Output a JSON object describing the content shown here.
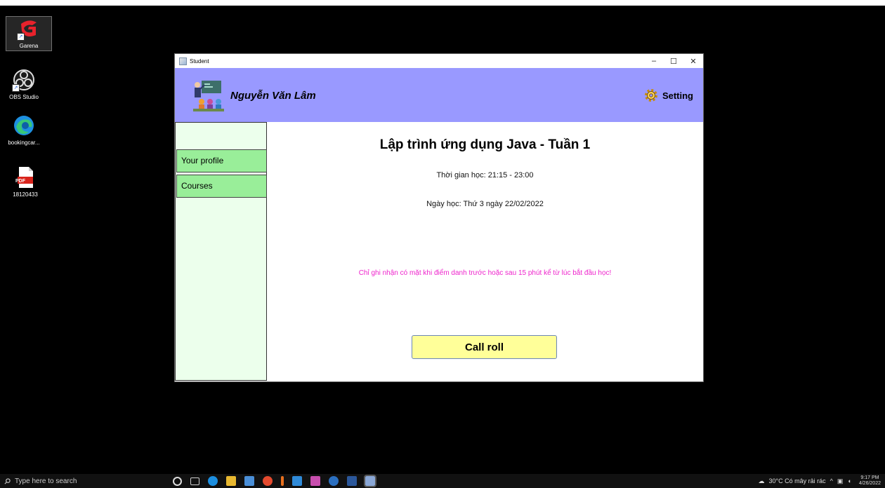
{
  "desktop": {
    "icons": [
      {
        "label": "Garena"
      },
      {
        "label": "OBS Studio"
      },
      {
        "label": "bookingcar..."
      },
      {
        "label": "18120433",
        "badge": "PDF"
      }
    ]
  },
  "window": {
    "title": "Student",
    "controls": {
      "minimize": "–",
      "maximize": "☐",
      "close": "✕"
    }
  },
  "header": {
    "user_name": "Nguyễn Văn Lâm",
    "setting_label": "Setting"
  },
  "sidebar": {
    "items": [
      {
        "label": "Your profile"
      },
      {
        "label": "Courses"
      }
    ]
  },
  "course": {
    "title": "Lập trình ứng dụng Java - Tuần 1",
    "time": "Thời gian học: 21:15 - 23:00",
    "date": "Ngày học: Thứ 3 ngày 22/02/2022",
    "note": "Chỉ ghi nhận có mặt khi điểm danh trước hoặc sau 15 phút kể từ lúc bắt đầu học!",
    "call_roll_label": "Call roll"
  },
  "taskbar": {
    "search_placeholder": "Type here to search",
    "weather": "30°C  Có mây rải rác",
    "time": "9:17 PM",
    "date": "4/26/2022"
  },
  "colors": {
    "header_bg": "#9999ff",
    "sidebar_bg": "#ecffec",
    "menu_item_bg": "#99ee99",
    "note_color": "#ee22cc",
    "button_bg": "#ffff99"
  }
}
